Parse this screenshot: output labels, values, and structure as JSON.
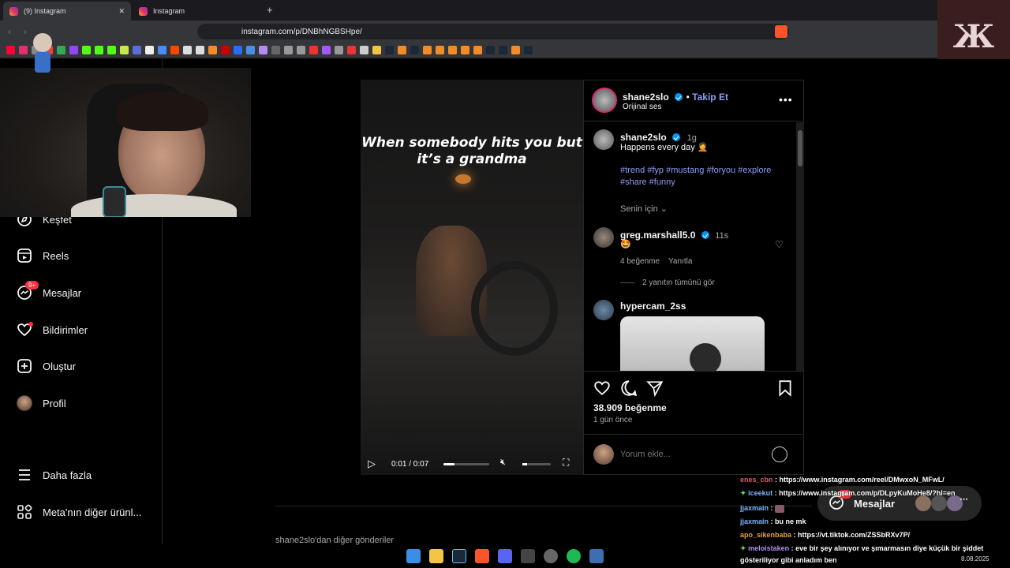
{
  "browser": {
    "tabs": [
      {
        "label": "(9) Instagram",
        "close": "✕"
      },
      {
        "label": "Instagram",
        "close": ""
      }
    ],
    "new_tab": "+",
    "url": "instagram.com/p/DNBhNGBSHpe/"
  },
  "channel_logo": "Ж",
  "sidebar": {
    "items": [
      {
        "label": "Keşfet",
        "icon": "compass-icon"
      },
      {
        "label": "Reels",
        "icon": "reels-icon"
      },
      {
        "label": "Mesajlar",
        "icon": "messenger-icon",
        "badge": "9+"
      },
      {
        "label": "Bildirimler",
        "icon": "heart-icon"
      },
      {
        "label": "Oluştur",
        "icon": "plus-square-icon"
      },
      {
        "label": "Profil",
        "icon": "profile-avatar"
      },
      {
        "label": "Daha fazla",
        "icon": "menu-icon"
      },
      {
        "label": "Meta'nın diğer ürünl...",
        "icon": "grid-icon"
      }
    ]
  },
  "post": {
    "video_caption": "When somebody hits you but it’s a grandma",
    "video_time": "0:01 / 0:07",
    "author": "shane2slo",
    "follow": "Takip Et",
    "audio": "Orijinal ses",
    "caption_time": "1g",
    "caption_text": "Happens every day 🤦",
    "hashtags": "#trend #fyp #mustang #foryou #explore #share #funny",
    "for_you": "Senin için",
    "comments": [
      {
        "user": "greg.marshall5.0",
        "time": "11s",
        "text": "🤩",
        "likes": "4 beğenme",
        "reply": "Yanıtla",
        "view_replies": "2 yanıtın tümünü gör"
      },
      {
        "user": "hypercam_2ss"
      }
    ],
    "like_count": "38.909 beğenme",
    "posted": "1 gün önce",
    "comment_placeholder": "Yorum ekle...",
    "more_from": "shane2slo'dan diğer gönderiler"
  },
  "messages_pill": {
    "label": "Mesajlar",
    "badge": "9+"
  },
  "chat": [
    {
      "user": "enes_cbn",
      "text": ": https://www.instagram.com/reel/DMwxoN_MFwL/"
    },
    {
      "user": "iceekut",
      "text": ": https://www.instagram.com/p/DLpyKuMoHe8/?hl=en"
    },
    {
      "user": "jjaxmain",
      "text": ":"
    },
    {
      "user": "jjaxmain",
      "text": ": bu ne mk"
    },
    {
      "user": "apo_sikenbaba",
      "text": ": https://vt.tiktok.com/ZSSbRXv7P/"
    },
    {
      "user": "meloistaken",
      "text": ": eve bir şey alınıyor ve şımarmasın diye küçük bir şiddet"
    },
    {
      "user": "",
      "text": "gösteriliyor gibi anladım ben"
    }
  ],
  "taskbar": {
    "date": "8.08.2025"
  }
}
